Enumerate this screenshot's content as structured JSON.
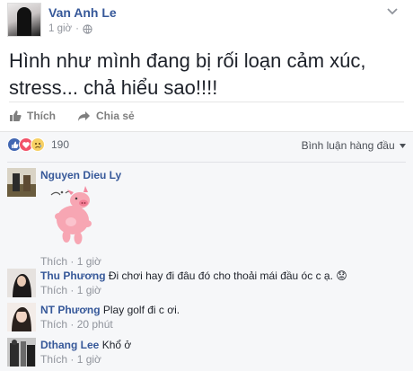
{
  "post": {
    "author": "Van Anh Le",
    "time": "1 giờ",
    "privacy_icon": "globe-icon",
    "options_icon": "chevron-down-icon",
    "text": "Hình như mình đang bị rối loạn cảm xúc, stress... chả hiểu sao!!!!"
  },
  "actions": {
    "like_label": "Thích",
    "share_label": "Chia sẻ"
  },
  "reactions": {
    "types": [
      "like",
      "love",
      "sad"
    ],
    "count": "190",
    "sort_label": "Bình luận hàng đầu"
  },
  "comments": [
    {
      "name": "Nguyen Dieu Ly",
      "text": "",
      "sticker": "pink-pig-sticker",
      "like_label": "Thích",
      "separator": " · ",
      "time": "1 giờ"
    },
    {
      "name": "Thu Phương",
      "text": "Đi chơi hay đi đâu đó cho thoải mái đầu óc c ạ. 😟",
      "like_label": "Thích",
      "separator": " · ",
      "time": "1 giờ"
    },
    {
      "name": "NT Phương",
      "text": "Play golf đi c ơi.",
      "like_label": "Thích",
      "separator": " · ",
      "time": "20 phút"
    },
    {
      "name": "Dthang Lee",
      "text": "Khổ ở",
      "like_label": "Thích",
      "separator": " · ",
      "time": "1 giờ"
    }
  ],
  "colors": {
    "link_blue": "#365899",
    "like_blue": "#4267b2",
    "muted": "#90949c",
    "panel_bg": "#f6f7f9"
  }
}
